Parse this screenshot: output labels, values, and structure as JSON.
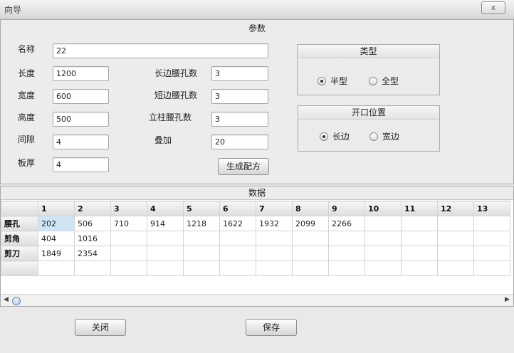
{
  "window": {
    "title": "向导",
    "close_label": "x"
  },
  "params": {
    "section_title": "参数",
    "name": {
      "label": "名称",
      "value": "22"
    },
    "length": {
      "label": "长度",
      "value": "1200"
    },
    "width": {
      "label": "宽度",
      "value": "600"
    },
    "height": {
      "label": "高度",
      "value": "500"
    },
    "gap": {
      "label": "间隙",
      "value": "4"
    },
    "thickness": {
      "label": "板厚",
      "value": "4"
    },
    "long_side_holes": {
      "label": "长边腰孔数",
      "value": "3"
    },
    "short_side_holes": {
      "label": "短边腰孔数",
      "value": "3"
    },
    "column_holes": {
      "label": "立柱腰孔数",
      "value": "3"
    },
    "overlap": {
      "label": "叠加",
      "value": "20"
    },
    "generate_label": "生成配方"
  },
  "type_group": {
    "title": "类型",
    "options": [
      {
        "label": "半型",
        "selected": true
      },
      {
        "label": "全型",
        "selected": false
      }
    ]
  },
  "opening_group": {
    "title": "开口位置",
    "options": [
      {
        "label": "长边",
        "selected": true
      },
      {
        "label": "宽边",
        "selected": false
      }
    ]
  },
  "data_table": {
    "title": "数据",
    "columns": [
      "1",
      "2",
      "3",
      "4",
      "5",
      "6",
      "7",
      "8",
      "9",
      "10",
      "11",
      "12",
      "13"
    ],
    "rows": [
      {
        "header": "腰孔",
        "cells": [
          "202",
          "506",
          "710",
          "914",
          "1218",
          "1622",
          "1932",
          "2099",
          "2266",
          "",
          "",
          "",
          ""
        ]
      },
      {
        "header": "剪角",
        "cells": [
          "404",
          "1016",
          "",
          "",
          "",
          "",
          "",
          "",
          "",
          "",
          "",
          "",
          ""
        ]
      },
      {
        "header": "剪刀",
        "cells": [
          "1849",
          "2354",
          "",
          "",
          "",
          "",
          "",
          "",
          "",
          "",
          "",
          "",
          ""
        ]
      },
      {
        "header": "",
        "cells": [
          "",
          "",
          "",
          "",
          "",
          "",
          "",
          "",
          "",
          "",
          "",
          "",
          ""
        ]
      }
    ]
  },
  "footer": {
    "close_label": "关闭",
    "save_label": "保存"
  },
  "colors": {
    "selected_cell": "#cfe4f6",
    "panel_bg": "#ececec"
  }
}
